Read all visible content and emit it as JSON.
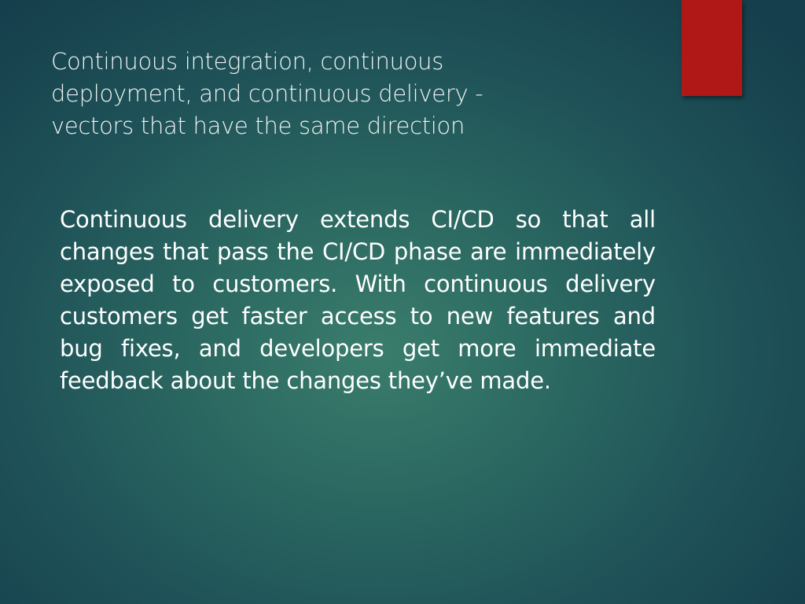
{
  "slide": {
    "title": " Continuous integration, continuous\ndeployment, and continuous delivery -\nvectors that have the same direction",
    "body": "Continuous delivery extends CI/CD so that all changes that pass the CI/CD phase are immediately exposed to customers. With continuous delivery customers get faster access to new features and bug fixes, and developers get more immediate feedback about the changes they’ve made.",
    "accent_color": "#b01818"
  }
}
